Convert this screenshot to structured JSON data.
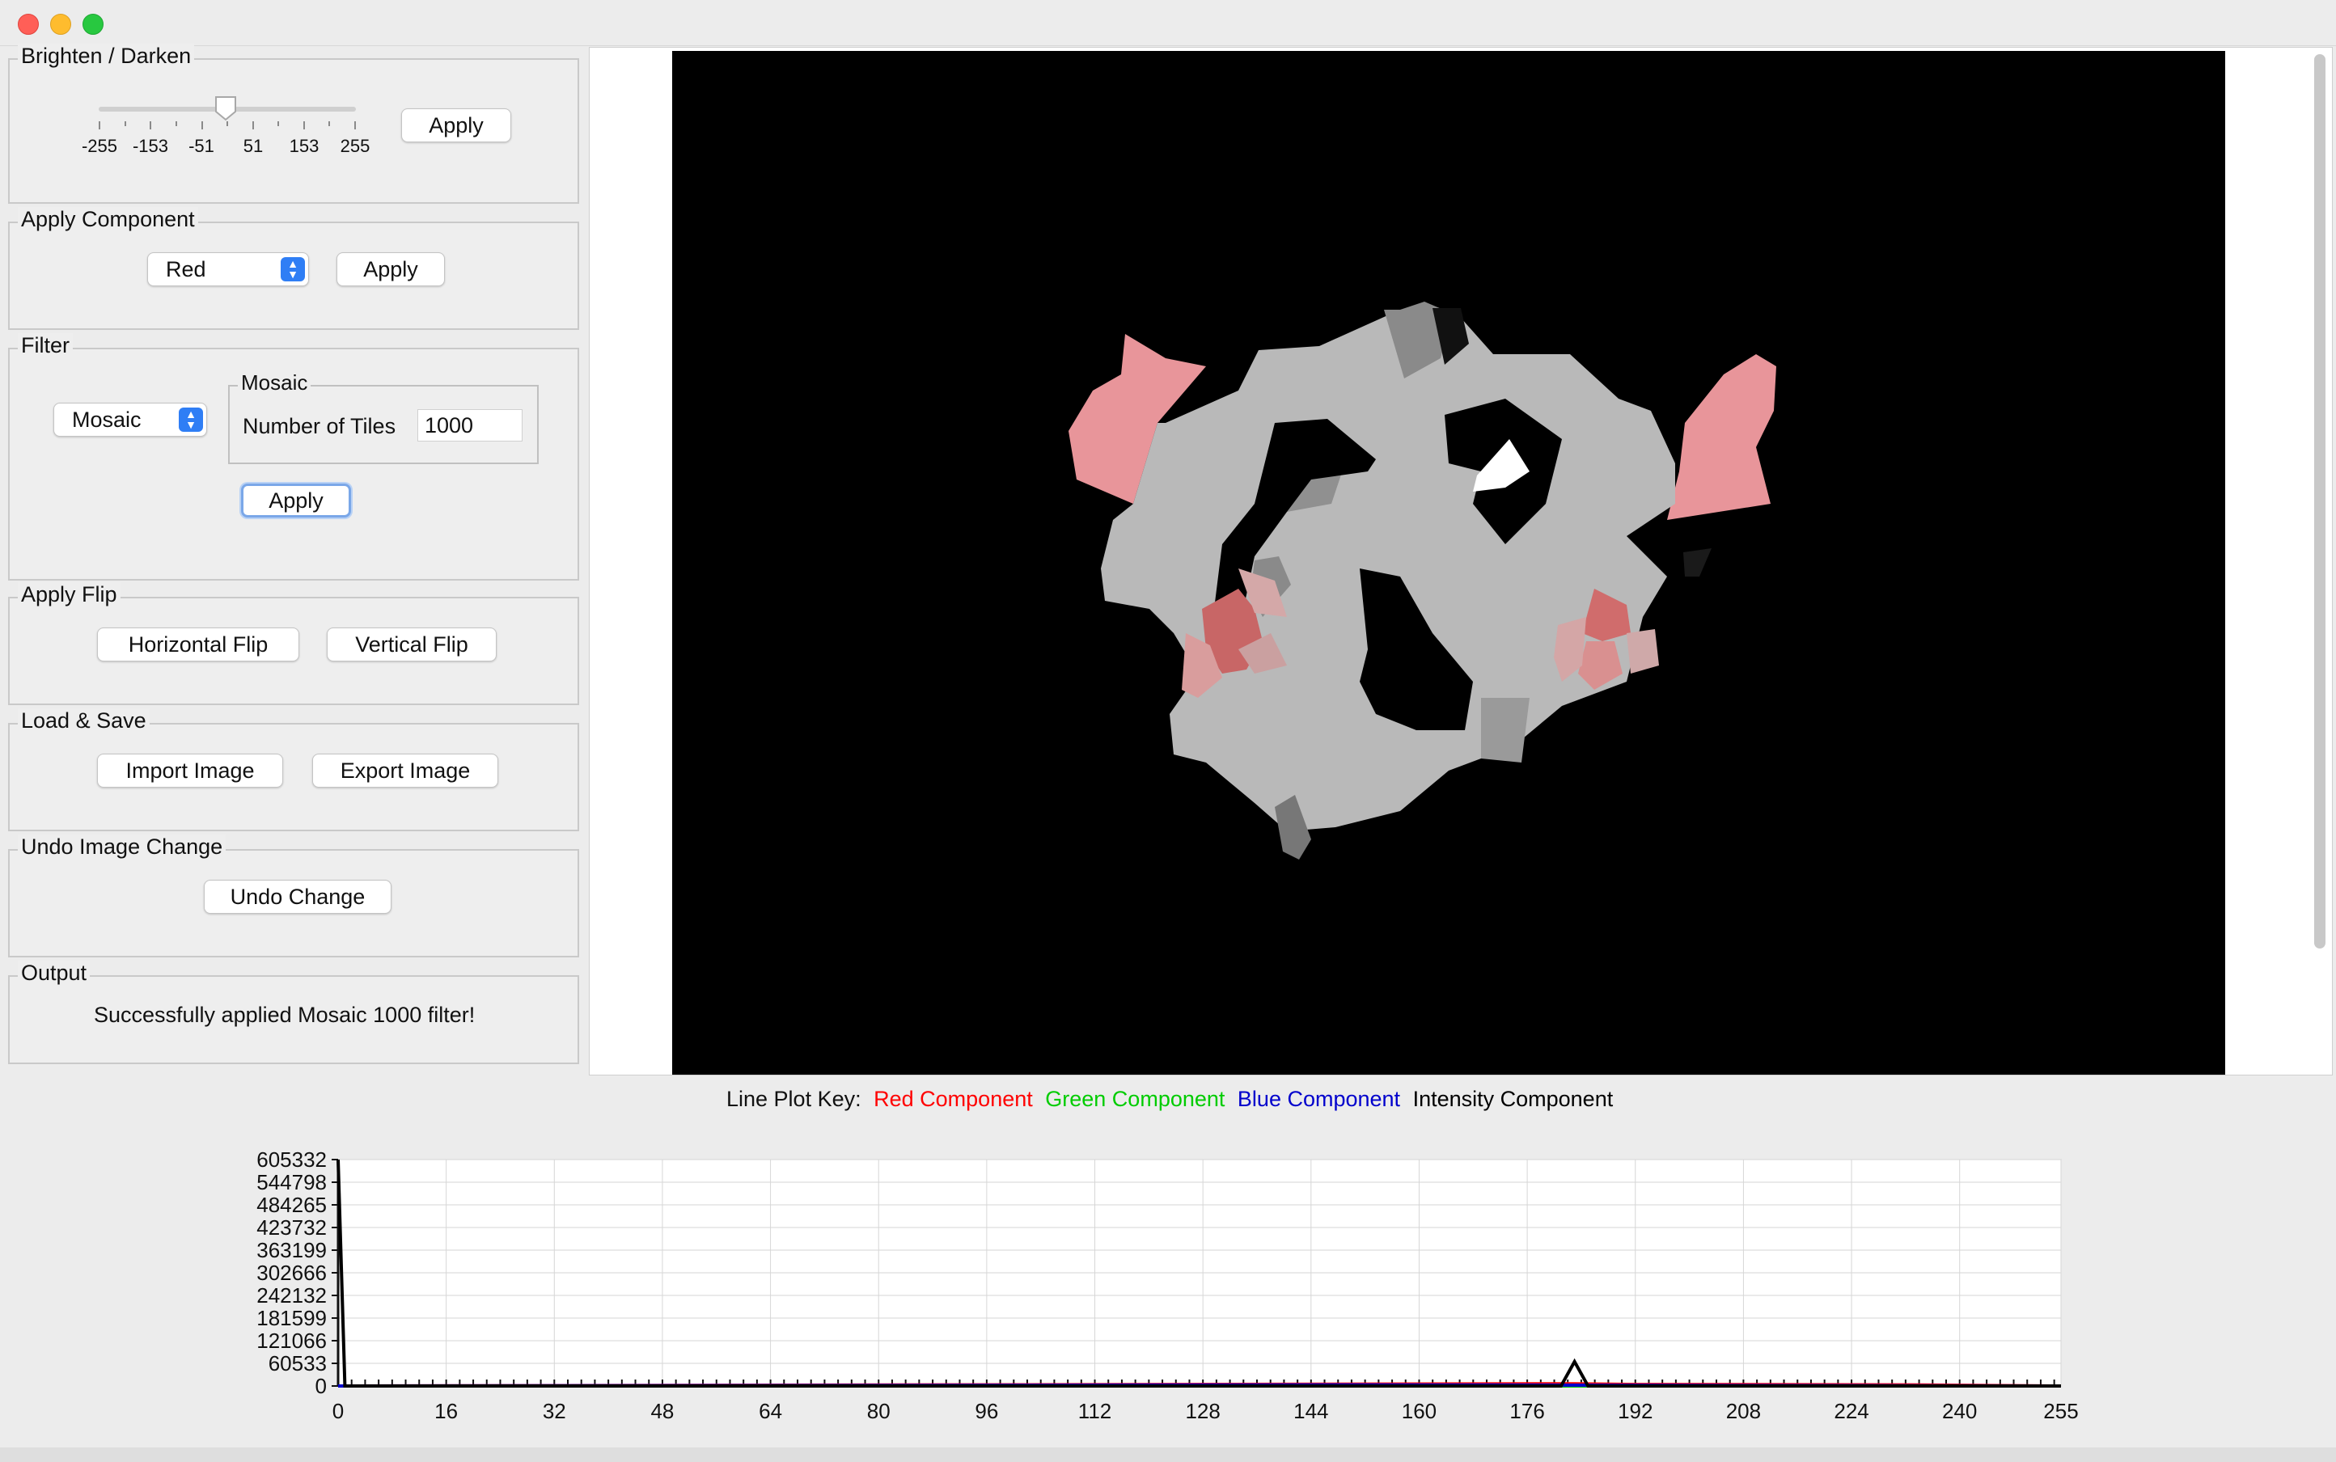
{
  "window": {
    "controls": [
      "close",
      "minimize",
      "maximize"
    ]
  },
  "brighten": {
    "title": "Brighten / Darken",
    "slider": {
      "min": -255,
      "max": 255,
      "value": 0
    },
    "tick_labels": [
      "-255",
      "-153",
      "-51",
      "51",
      "153",
      "255"
    ],
    "apply_label": "Apply"
  },
  "component": {
    "title": "Apply Component",
    "selected": "Red",
    "apply_label": "Apply"
  },
  "filter": {
    "title": "Filter",
    "selected": "Mosaic",
    "mosaic_title": "Mosaic",
    "tiles_label": "Number of Tiles",
    "tiles_value": "1000",
    "apply_label": "Apply"
  },
  "flip": {
    "title": "Apply Flip",
    "horizontal_label": "Horizontal Flip",
    "vertical_label": "Vertical Flip"
  },
  "load_save": {
    "title": "Load & Save",
    "import_label": "Import Image",
    "export_label": "Export Image"
  },
  "undo": {
    "title": "Undo Image Change",
    "undo_label": "Undo Change"
  },
  "output": {
    "title": "Output",
    "message": "Successfully applied Mosaic 1000 filter!"
  },
  "plot_key": {
    "prefix": "Line Plot Key:",
    "red": "Red Component",
    "green": "Green Component",
    "blue": "Blue Component",
    "intensity": "Intensity Component"
  },
  "colors": {
    "red": "#ff0000",
    "green": "#00cc00",
    "blue": "#0000cc",
    "intensity": "#000000",
    "accent": "#2f7ef5"
  },
  "chart_data": {
    "type": "line",
    "title": "",
    "xlabel": "",
    "ylabel": "",
    "xlim": [
      0,
      255
    ],
    "ylim": [
      0,
      605332
    ],
    "x_ticks": [
      "0",
      "16",
      "32",
      "48",
      "64",
      "80",
      "96",
      "112",
      "128",
      "144",
      "160",
      "176",
      "192",
      "208",
      "224",
      "240",
      "255"
    ],
    "y_ticks": [
      "0",
      "60533",
      "121066",
      "181599",
      "242132",
      "302666",
      "363199",
      "423732",
      "484265",
      "544798",
      "605332"
    ],
    "grid": true,
    "series": [
      {
        "name": "Red Component",
        "color": "#ff0000",
        "points": [
          [
            0,
            0
          ],
          [
            183,
            6000
          ],
          [
            192,
            4000
          ],
          [
            233,
            3000
          ],
          [
            255,
            0
          ]
        ]
      },
      {
        "name": "Green Component",
        "color": "#00cc00",
        "points": [
          [
            0,
            0
          ],
          [
            255,
            0
          ]
        ]
      },
      {
        "name": "Blue Component",
        "color": "#0000cc",
        "points": [
          [
            0,
            0
          ],
          [
            100,
            2000
          ],
          [
            150,
            3000
          ],
          [
            170,
            2500
          ],
          [
            255,
            0
          ]
        ]
      },
      {
        "name": "Intensity Component",
        "color": "#000000",
        "points": [
          [
            0,
            605332
          ],
          [
            1,
            0
          ],
          [
            181,
            0
          ],
          [
            183,
            65000
          ],
          [
            185,
            0
          ],
          [
            255,
            0
          ]
        ]
      }
    ]
  }
}
